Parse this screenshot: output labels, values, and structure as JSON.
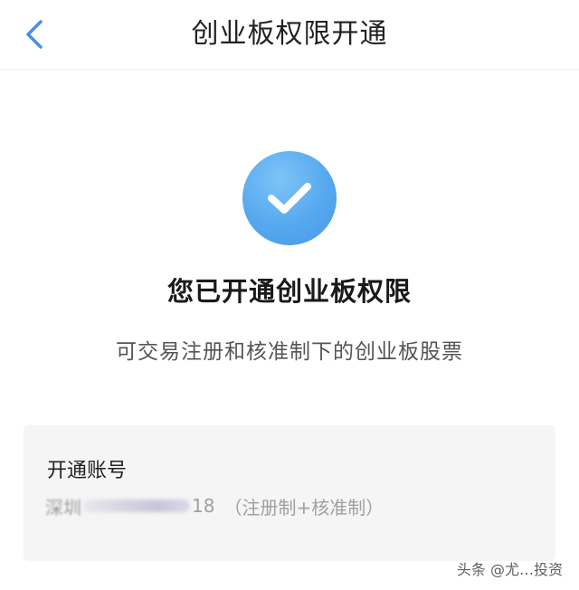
{
  "navbar": {
    "title": "创业板权限开通",
    "back_icon": "chevron-left-icon"
  },
  "status": {
    "icon": "check-circle-icon",
    "headline": "您已开通创业板权限",
    "subline": "可交易注册和核准制下的创业板股票"
  },
  "account": {
    "label": "开通账号",
    "value_prefix": "深圳",
    "value_suffix": "18",
    "mode": "（注册制+核准制）"
  },
  "watermark": "头条 @尤…投资",
  "colors": {
    "accent": "#4A98E6",
    "card_bg": "#F5F5F5",
    "back_icon": "#4A90E2"
  }
}
